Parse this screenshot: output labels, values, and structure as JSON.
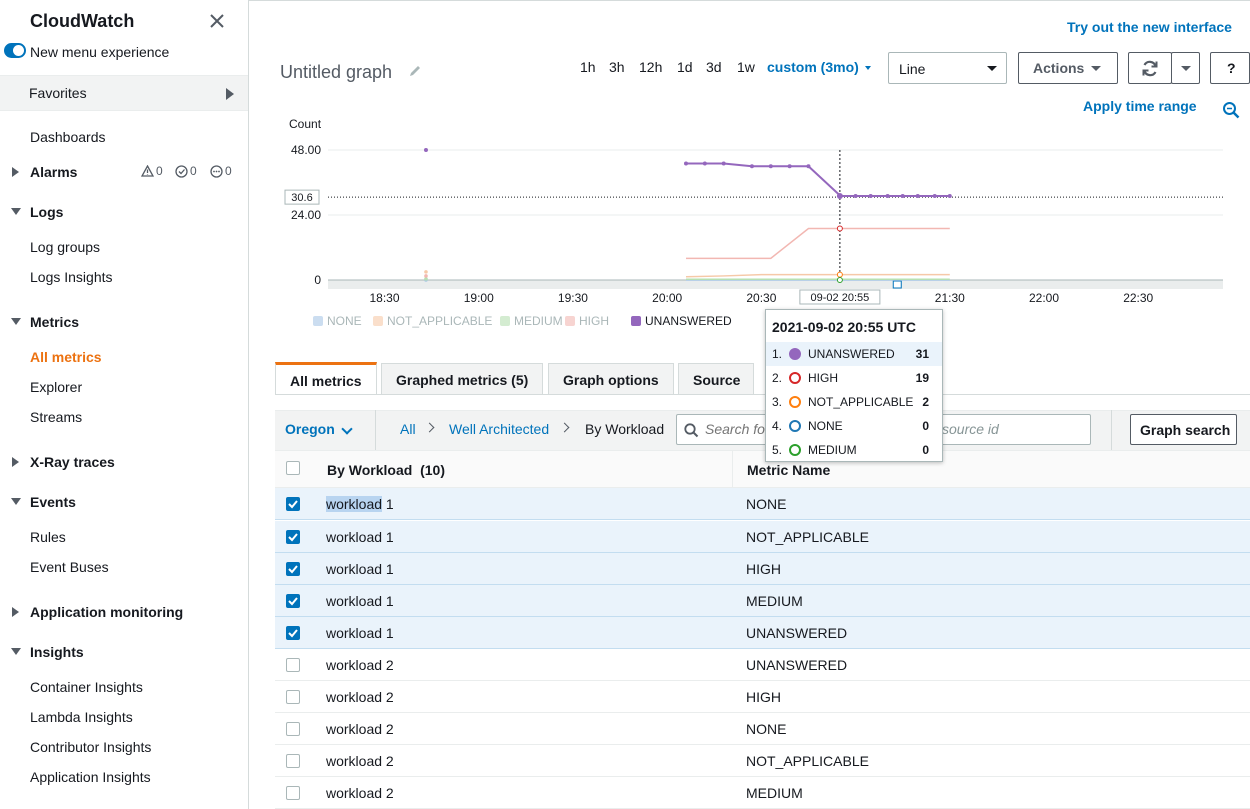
{
  "sidebar": {
    "title": "CloudWatch",
    "menu_toggle_label": "New menu experience",
    "favorites": "Favorites",
    "dashboards": "Dashboards",
    "alarms": {
      "label": "Alarms",
      "alarm_count": "0",
      "ok_count": "0",
      "insufficient_count": "0"
    },
    "logs": {
      "label": "Logs",
      "items": [
        "Log groups",
        "Logs Insights"
      ]
    },
    "metrics": {
      "label": "Metrics",
      "items": [
        "All metrics",
        "Explorer",
        "Streams"
      ]
    },
    "xray": "X-Ray traces",
    "events": {
      "label": "Events",
      "items": [
        "Rules",
        "Event Buses"
      ]
    },
    "app_monitoring": "Application monitoring",
    "insights": {
      "label": "Insights",
      "items": [
        "Container Insights",
        "Lambda Insights",
        "Contributor Insights",
        "Application Insights"
      ]
    }
  },
  "header": {
    "new_interface_link": "Try out the new interface",
    "graph_title": "Untitled graph",
    "ranges": [
      "1h",
      "3h",
      "12h",
      "1d",
      "3d",
      "1w"
    ],
    "custom_range": "custom (3mo)",
    "graph_type": "Line",
    "actions_label": "Actions",
    "help_label": "?",
    "apply_time_range": "Apply time range"
  },
  "chart_data": {
    "type": "line",
    "ylabel": "Count",
    "y_ticks": [
      "48.00",
      "24.00",
      "0"
    ],
    "x_ticks": [
      "18:30",
      "19:00",
      "19:30",
      "20:00",
      "20:30",
      "20:55",
      "21:30",
      "22:00",
      "22:30"
    ],
    "hover_x_label": "09-02 20:55",
    "hover_y_label": "30.6",
    "ylim": [
      0,
      48
    ],
    "x_domain_hours": [
      18.2,
      22.95
    ],
    "series": [
      {
        "name": "NONE",
        "color": "#a8c6e6",
        "points": [
          [
            18.72,
            0
          ],
          [
            20.1,
            0
          ],
          [
            20.25,
            0
          ],
          [
            20.45,
            0
          ],
          [
            20.6,
            0
          ],
          [
            20.7,
            0
          ],
          [
            20.75,
            0
          ],
          [
            21.0,
            0
          ],
          [
            21.25,
            0
          ],
          [
            21.5,
            0
          ]
        ]
      },
      {
        "name": "NOT_APPLICABLE",
        "color": "#f6c9a8",
        "points": [
          [
            18.72,
            3
          ],
          [
            20.1,
            1.2
          ],
          [
            20.3,
            1.5
          ],
          [
            20.5,
            2
          ],
          [
            20.9,
            2
          ],
          [
            21.5,
            2
          ]
        ]
      },
      {
        "name": "MEDIUM",
        "color": "#b7e0b2",
        "points": [
          [
            18.72,
            0.4
          ],
          [
            20.1,
            0.3
          ],
          [
            21.5,
            0.3
          ]
        ]
      },
      {
        "name": "HIGH",
        "color": "#f2b7b2",
        "points": [
          [
            18.72,
            1.5
          ],
          [
            20.1,
            8
          ],
          [
            20.55,
            8
          ],
          [
            20.75,
            19
          ],
          [
            20.92,
            19
          ],
          [
            21.5,
            19
          ]
        ]
      },
      {
        "name": "UNANSWERED",
        "color": "#9467bd",
        "points": [
          [
            18.72,
            48
          ],
          [
            20.1,
            43
          ],
          [
            20.2,
            43
          ],
          [
            20.3,
            43
          ],
          [
            20.45,
            42
          ],
          [
            20.55,
            42
          ],
          [
            20.65,
            42
          ],
          [
            20.75,
            42
          ],
          [
            20.92,
            31
          ],
          [
            21.0,
            31
          ],
          [
            21.08,
            31
          ],
          [
            21.17,
            31
          ],
          [
            21.25,
            31
          ],
          [
            21.33,
            31
          ],
          [
            21.42,
            31
          ],
          [
            21.5,
            31
          ]
        ]
      }
    ],
    "legend": [
      "NONE",
      "NOT_APPLICABLE",
      "MEDIUM",
      "HIGH",
      "UNANSWERED"
    ]
  },
  "tooltip": {
    "title": "2021-09-02 20:55 UTC",
    "rows": [
      {
        "idx": "1.",
        "name": "UNANSWERED",
        "value": "31",
        "color": "#9467bd"
      },
      {
        "idx": "2.",
        "name": "HIGH",
        "value": "19",
        "color": "#d62728"
      },
      {
        "idx": "3.",
        "name": "NOT_APPLICABLE",
        "value": "2",
        "color": "#ff7f0e"
      },
      {
        "idx": "4.",
        "name": "NONE",
        "value": "0",
        "color": "#1f77b4"
      },
      {
        "idx": "5.",
        "name": "MEDIUM",
        "value": "0",
        "color": "#2ca02c"
      }
    ]
  },
  "tabs": [
    "All metrics",
    "Graphed metrics (5)",
    "Graph options",
    "Source"
  ],
  "filter": {
    "region": "Oregon",
    "breadcrumb": [
      "All",
      "Well Architected",
      "By Workload"
    ],
    "search_placeholder": "Search fo",
    "search_suffix": "source id",
    "graph_search": "Graph search"
  },
  "table": {
    "col1": "By Workload",
    "col1_count": "(10)",
    "col2": "Metric Name",
    "rows": [
      {
        "workload": "workload 1",
        "metric": "NONE",
        "checked": true
      },
      {
        "workload": "workload 1",
        "metric": "NOT_APPLICABLE",
        "checked": true
      },
      {
        "workload": "workload 1",
        "metric": "HIGH",
        "checked": true
      },
      {
        "workload": "workload 1",
        "metric": "MEDIUM",
        "checked": true
      },
      {
        "workload": "workload 1",
        "metric": "UNANSWERED",
        "checked": true
      },
      {
        "workload": "workload 2",
        "metric": "UNANSWERED",
        "checked": false
      },
      {
        "workload": "workload 2",
        "metric": "HIGH",
        "checked": false
      },
      {
        "workload": "workload 2",
        "metric": "NONE",
        "checked": false
      },
      {
        "workload": "workload 2",
        "metric": "NOT_APPLICABLE",
        "checked": false
      },
      {
        "workload": "workload 2",
        "metric": "MEDIUM",
        "checked": false
      }
    ]
  }
}
